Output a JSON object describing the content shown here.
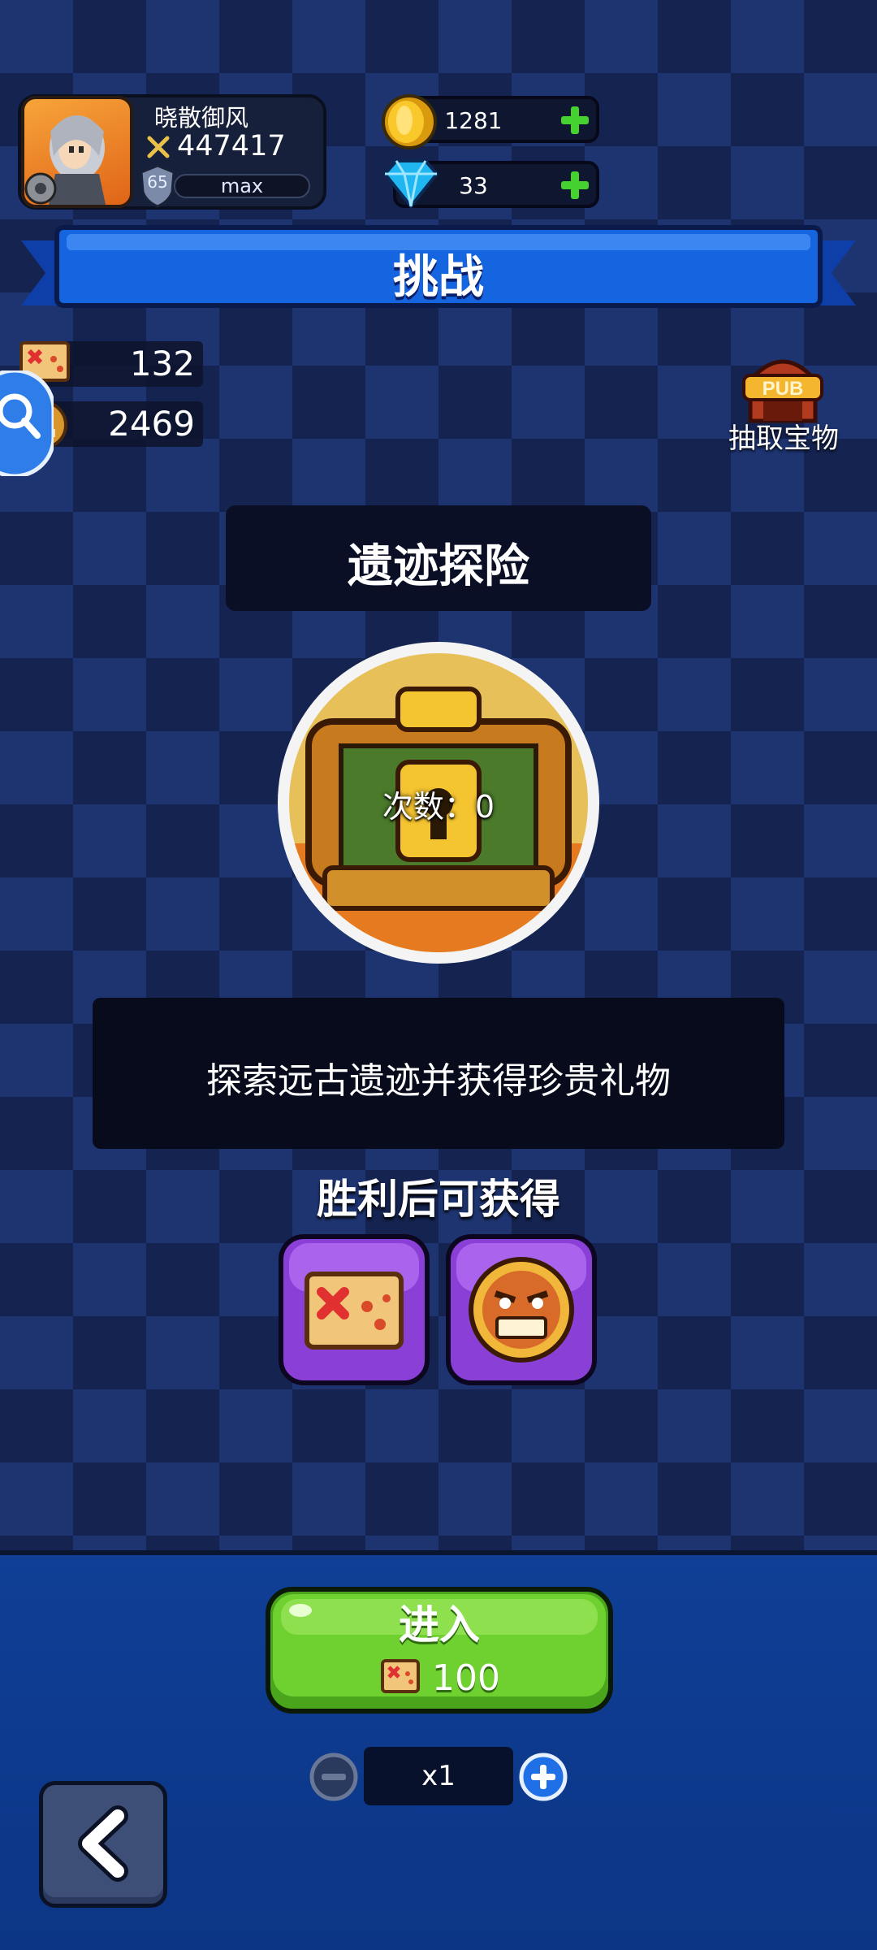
{
  "player": {
    "name": "晓散御风",
    "power": "447417",
    "level": "65",
    "exp_label": "max"
  },
  "currency": {
    "coins": "1281",
    "diamonds": "33"
  },
  "header": {
    "title": "挑战"
  },
  "resources": {
    "maps": "132",
    "masks": "2469"
  },
  "shop": {
    "label": "抽取宝物"
  },
  "mode": {
    "title": "遗迹探险",
    "attempts_label": "次数：0",
    "description": "探索远古遗迹并获得珍贵礼物",
    "rewards_title": "胜利后可获得",
    "rewards": [
      "treasure-map-icon",
      "tiki-mask-icon"
    ]
  },
  "action": {
    "enter_label": "进入",
    "enter_cost": "100",
    "quantity": "x1"
  },
  "colors": {
    "accent_green": "#6fd12f",
    "banner_blue": "#1565e0",
    "background_blue": "#1e3470"
  }
}
